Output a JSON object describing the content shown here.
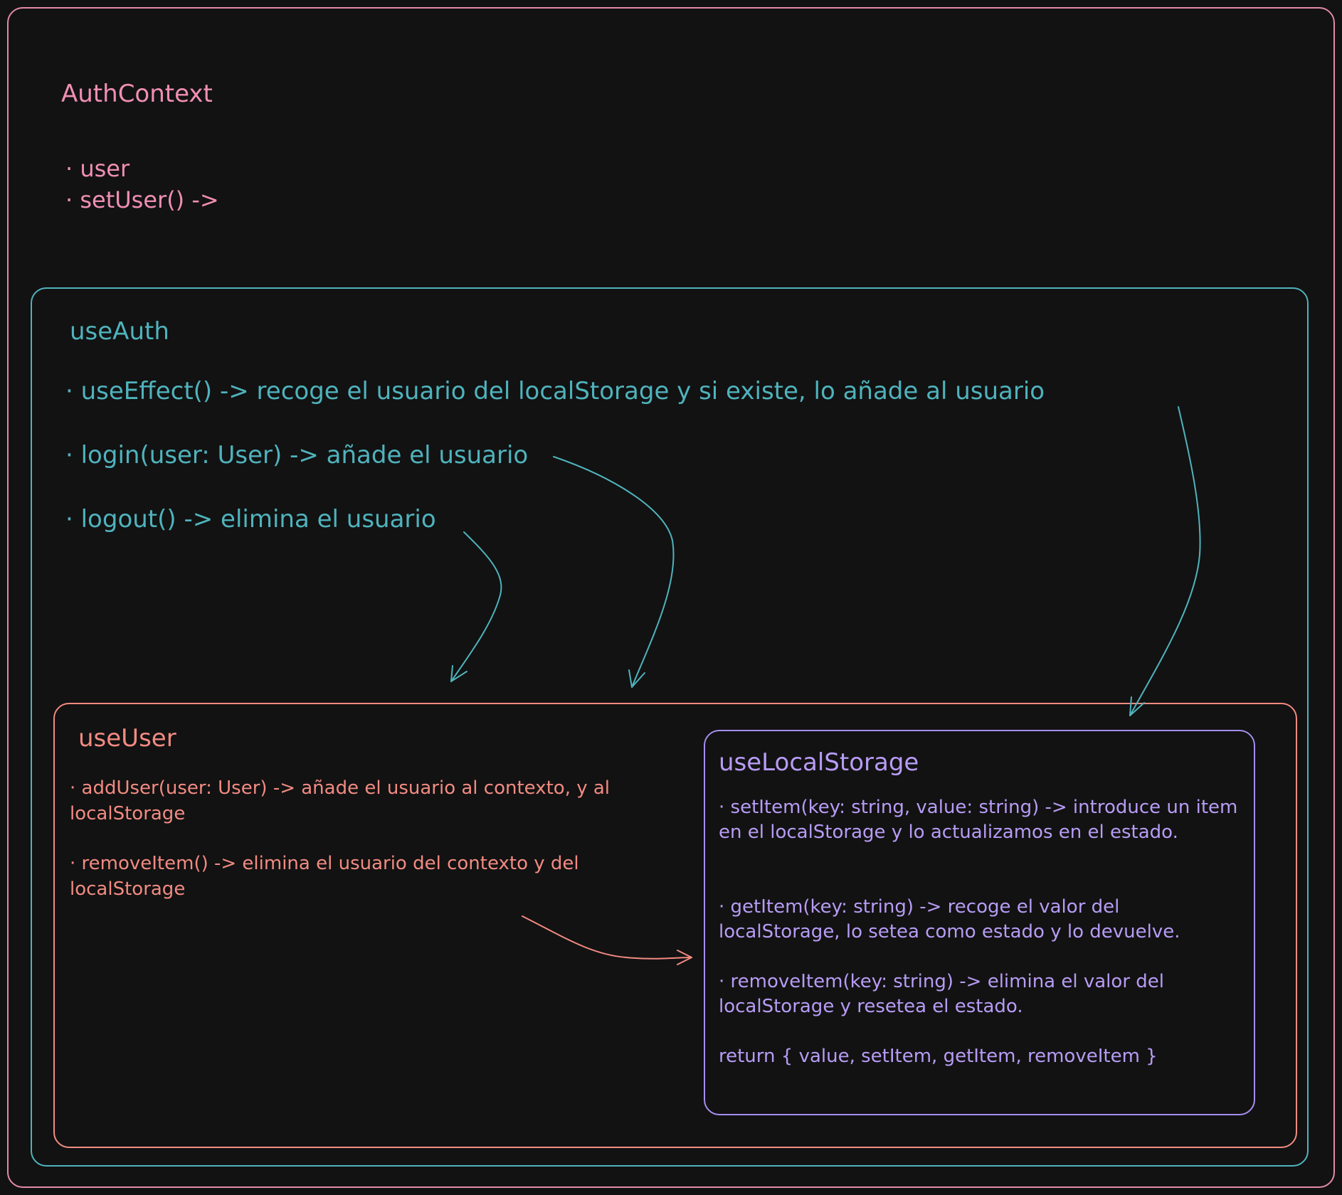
{
  "auth_context": {
    "title": "AuthContext",
    "items": [
      "· user",
      "· setUser() ->"
    ]
  },
  "use_auth": {
    "title": "useAuth",
    "items": [
      "· useEffect() -> recoge el usuario del localStorage y si existe, lo añade al usuario",
      "· login(user: User) -> añade el usuario",
      "· logout() -> elimina el usuario"
    ]
  },
  "use_user": {
    "title": "useUser",
    "items": [
      "· addUser(user: User) -> añade el usuario al contexto, y al localStorage",
      "· removeItem() -> elimina el usuario del contexto y del localStorage"
    ]
  },
  "use_local_storage": {
    "title": "useLocalStorage",
    "items": [
      "· setItem(key: string, value: string) -> introduce un item en el localStorage y lo actualizamos en el estado.",
      "· getItem(key: string) -> recoge el valor del localStorage, lo setea como estado y lo devuelve.",
      "· removeItem(key: string) -> elimina el valor del localStorage y resetea el estado.",
      "return { value, setItem, getItem, removeItem }"
    ]
  },
  "colors": {
    "background": "#121212",
    "auth_context": "#e38aa6",
    "use_auth": "#4fb3bd",
    "use_user": "#f28b82",
    "use_local_storage": "#a58ef0"
  }
}
